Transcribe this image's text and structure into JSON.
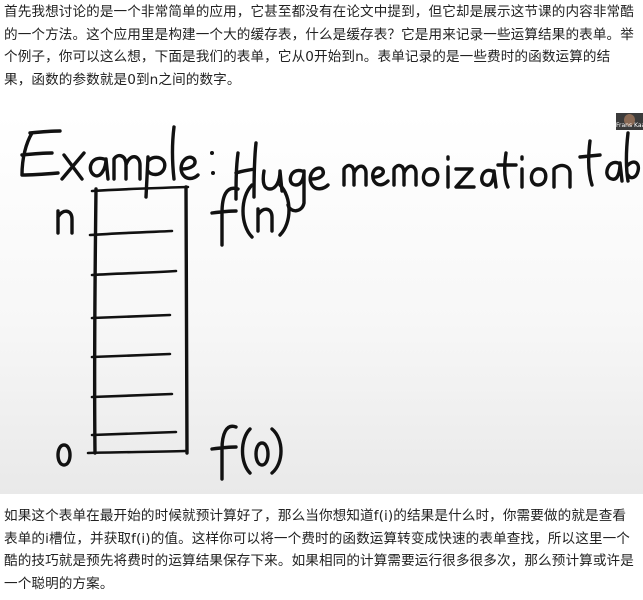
{
  "article": {
    "paragraph_1": "首先我想讨论的是一个非常简单的应用，它甚至都没有在论文中提到，但它却是展示这节课的内容非常酷的一个方法。这个应用里是构建一个大的缓存表，什么是缓存表？它是用来记录一些运算结果的表单。举个例子，你可以这么想，下面是我们的表单，它从0开始到n。表单记录的是一些费时的函数运算的结果，函数的参数就是0到n之间的数字。",
    "paragraph_2": "如果这个表单在最开始的时候就预计算好了，那么当你想知道f(i)的结果是什么时，你需要做的就是查看表单的i槽位，并获取f(i)的值。这样你可以将一个费时的函数运算转变成快速的表单查找，所以这里一个酷的技巧就是预先将费时的运算结果保存下来。如果相同的计算需要运行很多很多次，那么预计算或许是一个聪明的方案。"
  },
  "figure": {
    "webcam_label": "Frans Kaa",
    "handwriting": {
      "heading": "Example:",
      "title": "Huge memoization table",
      "top_index": "n",
      "top_value": "f(n)",
      "bottom_index": "0",
      "bottom_value": "f(0)"
    },
    "table_row_count": 9
  }
}
